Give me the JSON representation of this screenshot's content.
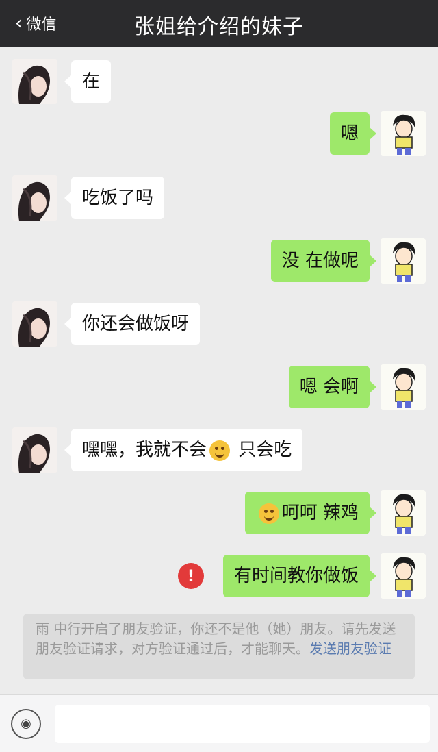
{
  "header": {
    "back_label": "微信",
    "title": "张姐给介绍的妹子"
  },
  "messages": [
    {
      "side": "in",
      "text": "在"
    },
    {
      "side": "out",
      "text": "嗯"
    },
    {
      "side": "in",
      "text": "吃饭了吗"
    },
    {
      "side": "out",
      "text": "没 在做呢"
    },
    {
      "side": "in",
      "text": "你还会做饭呀"
    },
    {
      "side": "out",
      "text": "嗯 会啊"
    },
    {
      "side": "in",
      "text_before": "嘿嘿，我就不会",
      "emoji": "smile-emoji",
      "text_after": " 只会吃"
    },
    {
      "side": "out",
      "emoji": "smile-emoji",
      "text": "呵呵 辣鸡"
    },
    {
      "side": "out",
      "text": "有时间教你做饭",
      "status": "send-failed",
      "status_glyph": "!"
    }
  ],
  "notice": {
    "line1": "雨 中行开启了朋友验证，你还不是他（她）朋友。请先发送朋友验证请求，对方验证通过后，才能聊天。",
    "link": "发送朋友验证"
  },
  "footer": {
    "voice_icon": "voice-icon",
    "voice_glyph": "◉",
    "input_value": ""
  },
  "colors": {
    "header_bg": "#2b2b2d",
    "chat_bg": "#ececec",
    "incoming_bubble": "#ffffff",
    "outgoing_bubble": "#9ee86a",
    "error_red": "#e23a3a",
    "link_blue": "#5a7bb0"
  }
}
